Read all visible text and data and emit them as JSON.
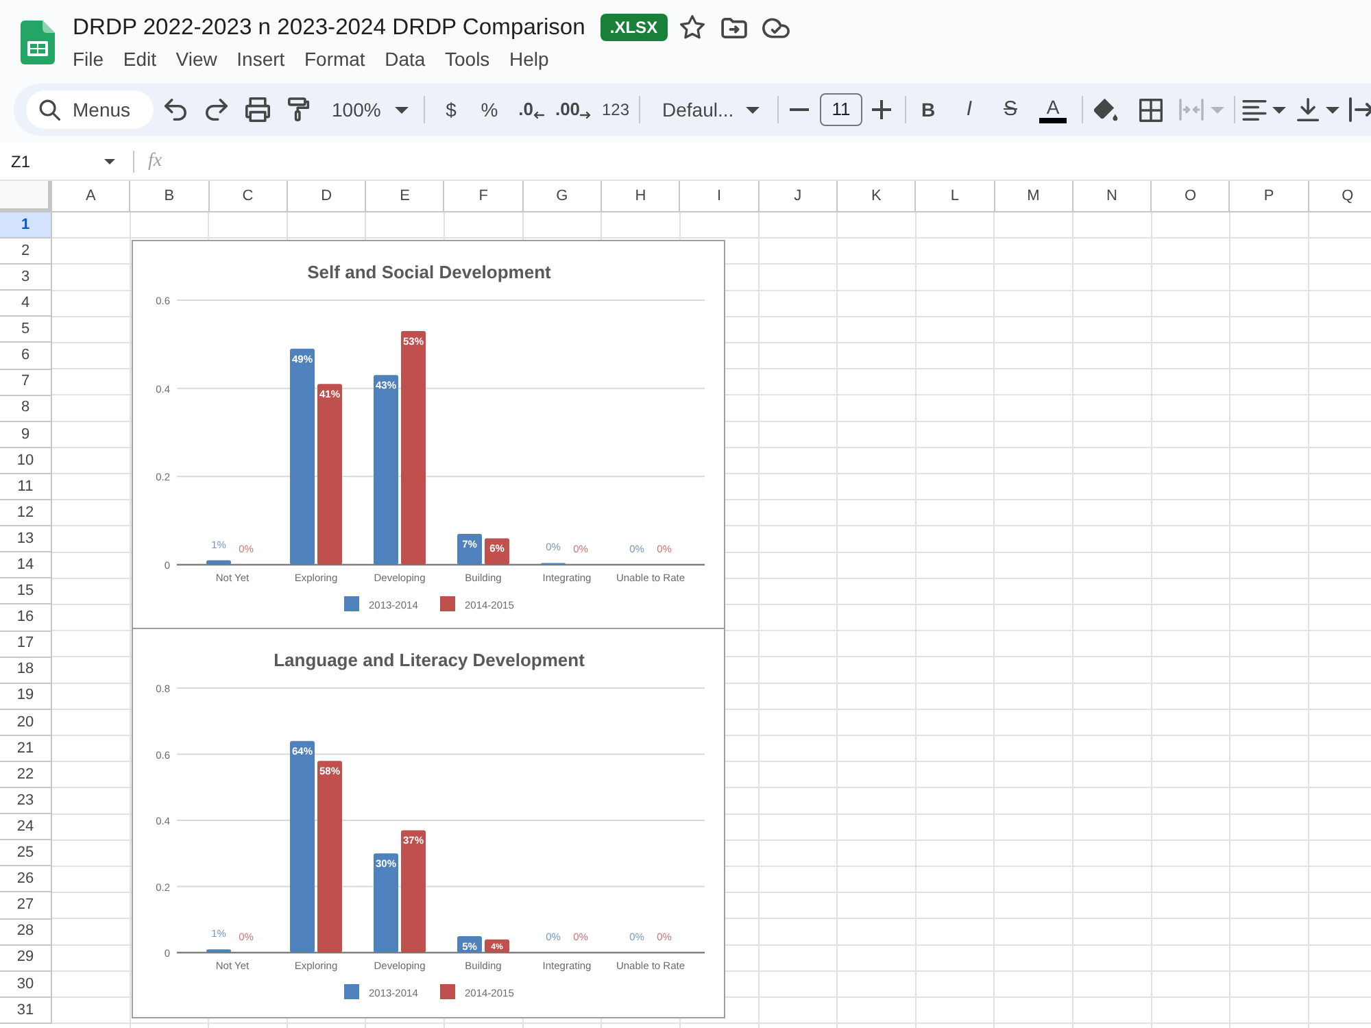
{
  "app": {
    "title": "DRDP 2022-2023 n 2023-2024 DRDP Comparison",
    "file_badge": ".XLSX"
  },
  "menu": [
    "File",
    "Edit",
    "View",
    "Insert",
    "Format",
    "Data",
    "Tools",
    "Help"
  ],
  "toolbar": {
    "search": "Menus",
    "zoom": "100%",
    "currency": "$",
    "percent": "%",
    "decrease_decimals": ".0",
    "increase_decimals": ".00",
    "more_formats": "123",
    "font": "Defaul...",
    "font_size": "11",
    "bold": "B",
    "italic": "I",
    "strikethrough": "S",
    "text_color": "A"
  },
  "formula_bar": {
    "name_box": "Z1",
    "label": "fx"
  },
  "columns": [
    "A",
    "B",
    "C",
    "D",
    "E",
    "F",
    "G",
    "H",
    "I",
    "J",
    "K",
    "L",
    "M",
    "N",
    "O",
    "P",
    "Q"
  ],
  "rows": [
    {
      "label": "1",
      "selected": true
    },
    {
      "label": "2",
      "selected": false
    },
    {
      "label": "3",
      "selected": false
    },
    {
      "label": "4",
      "selected": false
    },
    {
      "label": "5",
      "selected": false
    },
    {
      "label": "6",
      "selected": false
    },
    {
      "label": "7",
      "selected": false
    },
    {
      "label": "8",
      "selected": false
    },
    {
      "label": "9",
      "selected": false
    },
    {
      "label": "10",
      "selected": false
    },
    {
      "label": "11",
      "selected": false
    },
    {
      "label": "12",
      "selected": false
    },
    {
      "label": "13",
      "selected": false
    },
    {
      "label": "14",
      "selected": false
    },
    {
      "label": "15",
      "selected": false
    },
    {
      "label": "16",
      "selected": false
    },
    {
      "label": "17",
      "selected": false
    },
    {
      "label": "18",
      "selected": false
    },
    {
      "label": "19",
      "selected": false
    },
    {
      "label": "20",
      "selected": false
    },
    {
      "label": "21",
      "selected": false
    },
    {
      "label": "22",
      "selected": false
    },
    {
      "label": "23",
      "selected": false
    },
    {
      "label": "24",
      "selected": false
    },
    {
      "label": "25",
      "selected": false
    },
    {
      "label": "26",
      "selected": false
    },
    {
      "label": "27",
      "selected": false
    },
    {
      "label": "28",
      "selected": false
    },
    {
      "label": "29",
      "selected": false
    },
    {
      "label": "30",
      "selected": false
    },
    {
      "label": "31",
      "selected": false
    }
  ],
  "charts": [
    {
      "chart_data": {
        "type": "bar",
        "title": "Self and Social Development",
        "categories": [
          "Not Yet",
          "Exploring",
          "Developing",
          "Building",
          "Integrating",
          "Unable to Rate"
        ],
        "series": [
          {
            "name": "2013-2014",
            "color": "#4f81bd",
            "values": [
              0.01,
              0.49,
              0.43,
              0.07,
              0.004,
              0
            ]
          },
          {
            "name": "2014-2015",
            "color": "#c0504d",
            "values": [
              0,
              0.41,
              0.53,
              0.06,
              0,
              0
            ]
          }
        ],
        "ylim": [
          0,
          0.6
        ],
        "yticks": [
          0,
          0.2,
          0.4,
          0.6
        ],
        "grid": true,
        "legend": "bottom",
        "value_labels": [
          [
            "1%",
            "49%",
            "43%",
            "7%",
            "0%",
            "0%"
          ],
          [
            "0%",
            "41%",
            "53%",
            "6%",
            "0%",
            "0%"
          ]
        ]
      }
    },
    {
      "chart_data": {
        "type": "bar",
        "title": "Language and Literacy Development",
        "categories": [
          "Not Yet",
          "Exploring",
          "Developing",
          "Building",
          "Integrating",
          "Unable to Rate"
        ],
        "series": [
          {
            "name": "2013-2014",
            "color": "#4f81bd",
            "values": [
              0.01,
              0.64,
              0.3,
              0.05,
              0,
              0
            ]
          },
          {
            "name": "2014-2015",
            "color": "#c0504d",
            "values": [
              0,
              0.58,
              0.37,
              0.04,
              0,
              0
            ]
          }
        ],
        "ylim": [
          0,
          0.8
        ],
        "yticks": [
          0,
          0.2,
          0.4,
          0.6,
          0.8
        ],
        "grid": true,
        "legend": "bottom",
        "value_labels": [
          [
            "1%",
            "64%",
            "30%",
            "5%",
            "0%",
            "0%"
          ],
          [
            "0%",
            "58%",
            "37%",
            "4%",
            "0%",
            "0%"
          ]
        ]
      }
    }
  ]
}
